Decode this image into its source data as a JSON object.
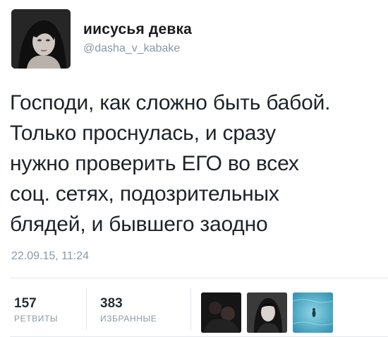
{
  "author": {
    "display_name": "иисусья девка",
    "handle": "@dasha_v_kabake"
  },
  "tweet": {
    "text_lines": [
      "Господи, как сложно быть бабой.",
      "Только проснулась, и сразу",
      "нужно проверить ЕГО во всех",
      "соц. сетях, подозрительных",
      "блядей, и бывшего заодно"
    ],
    "timestamp": "22.09.15, 11:24"
  },
  "stats": {
    "retweets": {
      "count": "157",
      "label": "РЕТВИТЫ"
    },
    "favorites": {
      "count": "383",
      "label": "ИЗБРАННЫЕ"
    }
  },
  "icons": {
    "avatar": "profile-photo",
    "favoriter_1": "user-avatar-dark",
    "favoriter_2": "user-avatar-portrait",
    "favoriter_3": "user-avatar-ocean"
  },
  "colors": {
    "text": "#1d2329",
    "muted": "#8899a6",
    "divider": "#e1e8ed"
  }
}
